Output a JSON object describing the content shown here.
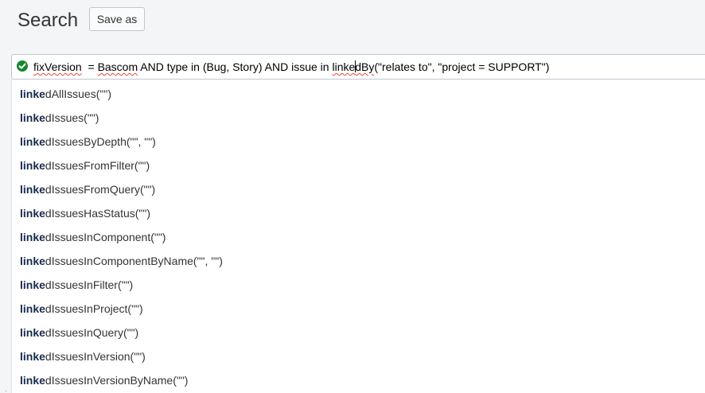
{
  "header": {
    "title": "Search",
    "save_as_label": "Save as"
  },
  "search_bar": {
    "status_icon": "valid-check-icon",
    "status_color": "#14892c",
    "query": {
      "field": "fixVersion",
      "op1": "  = ",
      "value1": "Bascom",
      "mid": " AND type in (Bug, Story) AND issue in ",
      "func_before_caret": "linke",
      "func_after_caret": "dBy",
      "args": "(\"relates to\", \"project = SUPPORT\")"
    }
  },
  "autocomplete": {
    "match_prefix": "linke",
    "items": [
      {
        "rest": "dAllIssues(\"\")"
      },
      {
        "rest": "dIssues(\"\")"
      },
      {
        "rest": "dIssuesByDepth(\"\", \"\")"
      },
      {
        "rest": "dIssuesFromFilter(\"\")"
      },
      {
        "rest": "dIssuesFromQuery(\"\")"
      },
      {
        "rest": "dIssuesHasStatus(\"\")"
      },
      {
        "rest": "dIssuesInComponent(\"\")"
      },
      {
        "rest": "dIssuesInComponentByName(\"\", \"\")"
      },
      {
        "rest": "dIssuesInFilter(\"\")"
      },
      {
        "rest": "dIssuesInProject(\"\")"
      },
      {
        "rest": "dIssuesInQuery(\"\")"
      },
      {
        "rest": "dIssuesInVersion(\"\")"
      },
      {
        "rest": "dIssuesInVersionByName(\"\")"
      }
    ]
  }
}
